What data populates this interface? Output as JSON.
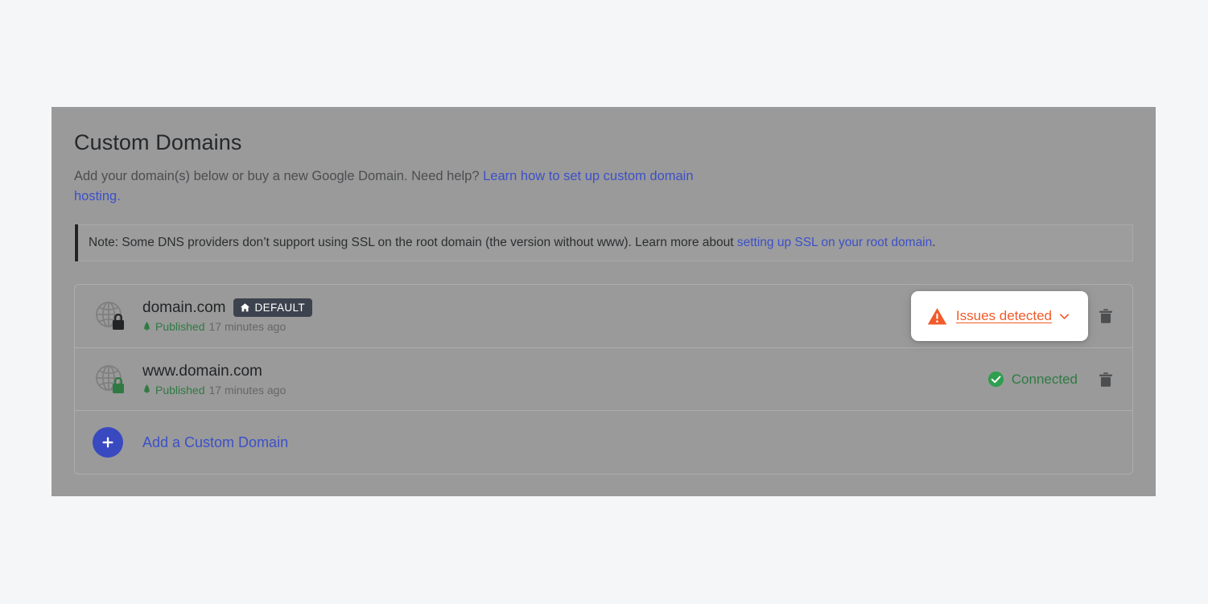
{
  "theme": {
    "page_background": "#f4f6f8",
    "panel_overlay": "#9a9a9a",
    "link_color": "#3c50c8",
    "success_color": "#2f7a43",
    "warning_color": "#f15a29",
    "badge_background": "#3c434e",
    "accent_bar": "#222426"
  },
  "header": {
    "title": "Custom Domains",
    "description_prefix": "Add your domain(s) below or buy a new Google Domain. Need help? ",
    "description_link": "Learn how to set up custom domain hosting.",
    "note": {
      "text_prefix": "Note: Some DNS providers don’t support using SSL on the root domain (the version without www). Learn more about ",
      "link": "setting up SSL on your root domain",
      "text_suffix": "."
    }
  },
  "domains": [
    {
      "icon": "globe-lock-icon",
      "lock_color": "#222426",
      "name": "domain.com",
      "badge": {
        "icon": "home-icon",
        "label": "DEFAULT"
      },
      "status_label": "Published",
      "status_icon": "rocket-icon",
      "timestamp": "17 minutes ago",
      "right_status": {
        "kind": "issues",
        "icon": "warning-triangle-icon",
        "label": "Issues detected",
        "chevron": "chevron-down-icon"
      },
      "delete_icon": "trash-icon"
    },
    {
      "icon": "globe-lock-icon",
      "lock_color": "#2f7a43",
      "name": "www.domain.com",
      "badge": null,
      "status_label": "Published",
      "status_icon": "rocket-icon",
      "timestamp": "17 minutes ago",
      "right_status": {
        "kind": "connected",
        "icon": "check-circle-icon",
        "label": "Connected"
      },
      "delete_icon": "trash-icon"
    }
  ],
  "add_row": {
    "icon": "plus-icon",
    "label": "Add a Custom Domain"
  }
}
